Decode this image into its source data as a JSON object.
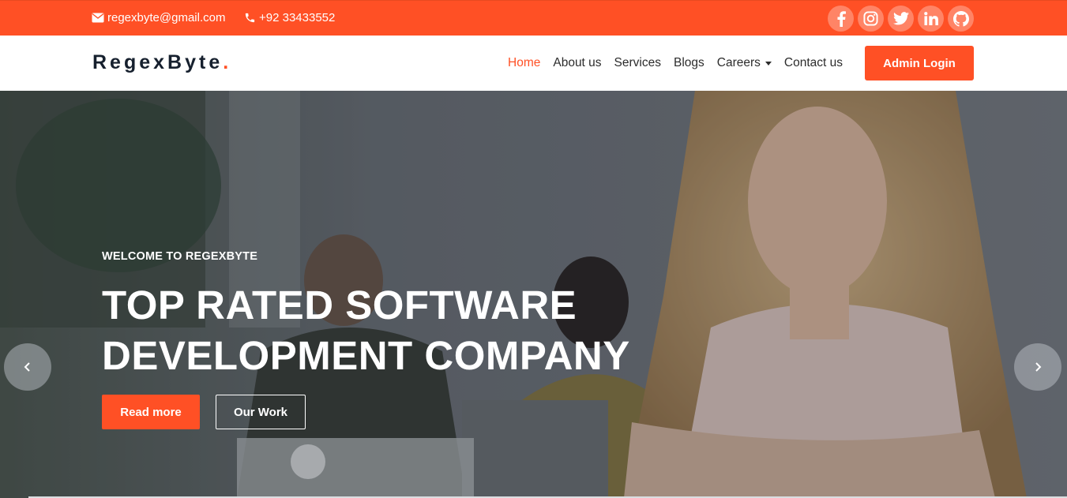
{
  "topbar": {
    "email": "regexbyte@gmail.com",
    "phone": "+92 33433552",
    "socials": [
      "facebook-icon",
      "instagram-icon",
      "twitter-icon",
      "linkedin-icon",
      "github-icon"
    ]
  },
  "navbar": {
    "brand": "RegexByte",
    "brand_dot": ".",
    "links": [
      {
        "label": "Home",
        "active": true
      },
      {
        "label": "About us"
      },
      {
        "label": "Services"
      },
      {
        "label": "Blogs"
      },
      {
        "label": "Careers",
        "dropdown": true
      },
      {
        "label": "Contact us"
      }
    ],
    "admin_button": "Admin Login"
  },
  "hero": {
    "subtitle": "WELCOME TO REGEXBYTE",
    "title_line1": "TOP RATED SOFTWARE",
    "title_line2": "DEVELOPMENT COMPANY",
    "primary_button": "Read more",
    "secondary_button": "Our Work",
    "prev_icon": "chevron-left-icon",
    "next_icon": "chevron-right-icon"
  },
  "colors": {
    "accent": "#ff5025",
    "brand_text": "#16202e"
  }
}
